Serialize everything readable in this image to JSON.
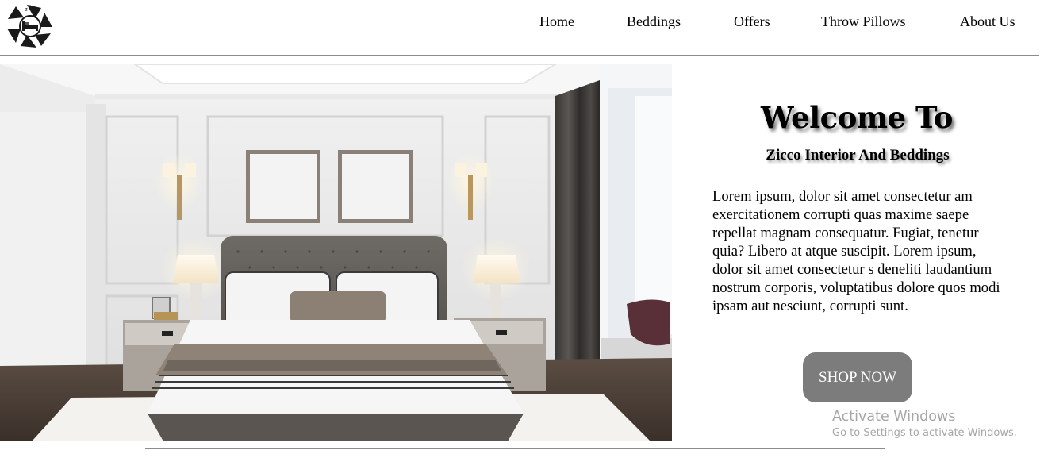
{
  "header": {
    "logo_name": "bedding-logo",
    "nav": [
      {
        "label": "Home"
      },
      {
        "label": "Beddings"
      },
      {
        "label": "Offers"
      },
      {
        "label": "Throw Pillows"
      },
      {
        "label": "About Us"
      }
    ]
  },
  "hero": {
    "image_name": "bedroom-photo",
    "title": "Welcome To",
    "subtitle": "Zicco Interior And Beddings",
    "body": "Lorem ipsum, dolor sit amet consectetur am exercitationem corrupti quas maxime saepe repellat magnam consequatur. Fugiat, tenetur quia? Libero at atque suscipit. Lorem ipsum, dolor sit amet consectetur s deneliti laudantium nostrum corporis, voluptatibus dolore quos modi ipsam aut nesciunt, corrupti sunt.",
    "cta_label": "SHOP NOW"
  },
  "watermark": {
    "title": "Activate Windows",
    "subtitle": "Go to Settings to activate Windows."
  },
  "colors": {
    "button_bg": "#7c7c7c",
    "rule": "#8c8c8c",
    "watermark": "#a6a6a6"
  }
}
